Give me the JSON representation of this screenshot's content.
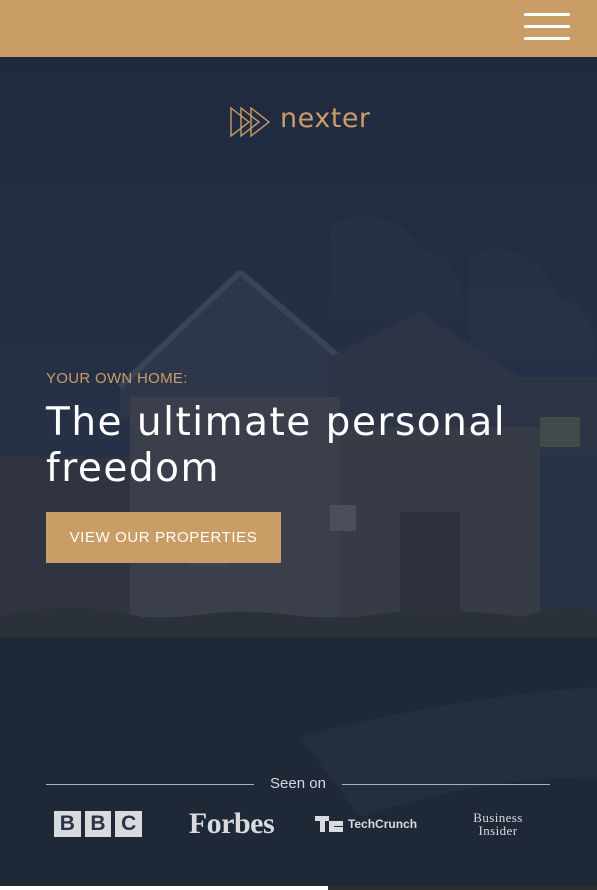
{
  "header": {
    "menu_icon": "hamburger-menu-icon",
    "bg_color": "#c99d65"
  },
  "logo": {
    "text": "nexter",
    "icon": "triple-play-arrows-icon",
    "color": "#c99d65"
  },
  "hero": {
    "eyebrow": "YOUR OWN HOME:",
    "headline": "The ultimate personal freedom",
    "cta_label": "VIEW OUR PROPERTIES"
  },
  "seen_on": {
    "label": "Seen on",
    "brands": [
      {
        "name": "BBC",
        "letters": [
          "B",
          "B",
          "C"
        ]
      },
      {
        "name": "Forbes"
      },
      {
        "name": "TechCrunch"
      },
      {
        "name": "Business Insider",
        "lines": [
          "Business",
          "Insider"
        ]
      }
    ]
  },
  "carousel": {
    "progress": 0.55
  },
  "colors": {
    "accent": "#c99d65",
    "overlay": "#1f2a3d",
    "text": "#ffffff"
  }
}
